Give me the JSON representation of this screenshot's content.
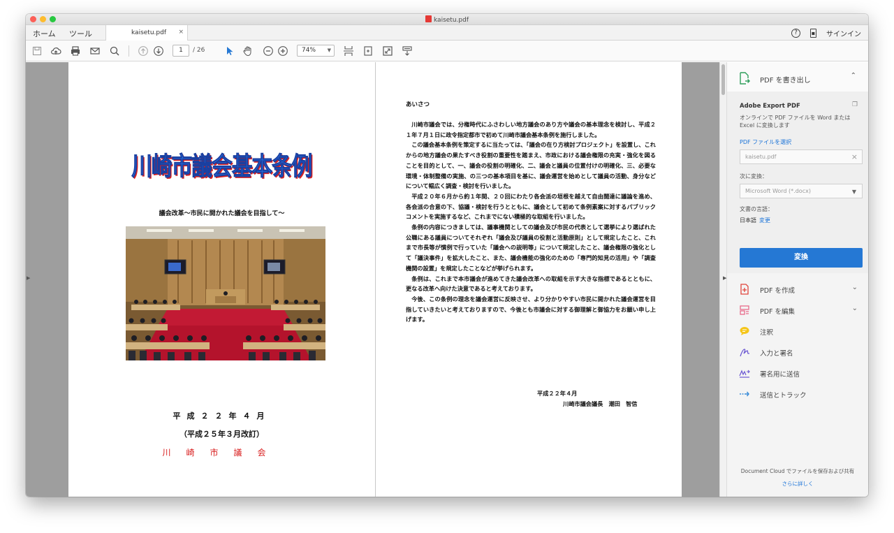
{
  "window": {
    "title": "kaisetu.pdf"
  },
  "tabbar": {
    "home": "ホーム",
    "tools": "ツール",
    "doc_tab": "kaisetu.pdf",
    "help_icon": "?",
    "sign_in": "サインイン"
  },
  "toolbar": {
    "page_current": "1",
    "page_total": "/ 26",
    "zoom": "74%"
  },
  "page_left": {
    "title": "川崎市議会基本条例",
    "subtitle": "議会改革～市民に開かれた議会を目指して～",
    "date": "平成２２年４月",
    "revision": "（平成２５年３月改訂）",
    "organization": "川崎市議会"
  },
  "page_right": {
    "heading": "あいさつ",
    "paragraphs": [
      "川崎市議会では、分権時代にふさわしい地方議会のあり方や議会の基本理念を検討し、平成２１年７月１日に政令指定都市で初めて川崎市議会基本条例を施行しました。",
      "この議会基本条例を策定するに当たっては、「議会の在り方検討プロジェクト」を設置し、これからの地方議会の果たすべき役割の重要性を踏まえ、市政における議会権限の充実・強化を図ることを目的として、一、議会の役割の明確化、二、議会と議員の位置付けの明確化、三、必要な環境・体制整備の実施、の三つの基本項目を基に、議会運営を始めとして議員の活動、身分などについて幅広く調査・検討を行いました。",
      "平成２０年６月から約１年間、２０回にわたり各会派の垣根を越えて自由闊達に議論を進め、各会派の合意の下、協議・検討を行うとともに、議会として初めて条例素案に対するパブリックコメントを実施するなど、これまでにない積極的な取組を行いました。",
      "条例の内容につきましては、議事機関としての議会及び市民の代表として選挙により選ばれた公職にある議員についてそれぞれ「議会及び議員の役割と活動原則」として規定したこと、これまで市長等が慣例で行っていた「議会への説明等」について規定したこと、議会権限の強化として「議決事件」を拡大したこと、また、議会機能の強化のための「専門的知見の活用」や「調査機関の設置」を規定したことなどが挙げられます。",
      "条例は、これまで本市議会が進めてきた議会改革への取組を示す大きな指標であるとともに、更なる改革へ向けた決意であると考えております。",
      "今後、この条例の理念を議会運営に反映させ、より分かりやすい市民に開かれた議会運営を目指していきたいと考えておりますので、今後とも市議会に対する御理解と御協力をお願い申し上げます。"
    ],
    "sign_date": "平成２２年４月",
    "sign_name": "川崎市議会議長　潮田　智信"
  },
  "side_panel": {
    "export_header": "PDF を書き出し",
    "export_title": "Adobe Export PDF",
    "export_desc": "オンラインで PDF ファイルを Word または Excel に変換します",
    "select_file_link": "PDF ファイルを選択",
    "file_input_value": "kaisetu.pdf",
    "convert_to_label": "次に変換：",
    "convert_to_value": "Microsoft Word (*.docx)",
    "language_label": "文書の言語：",
    "language_value": "日本語",
    "language_change": "変更",
    "convert_button": "変換",
    "tools": [
      {
        "label": "PDF を作成",
        "icon": "create-pdf-icon",
        "chevron": "⌄"
      },
      {
        "label": "PDF を編集",
        "icon": "edit-pdf-icon",
        "chevron": "⌄"
      },
      {
        "label": "注釈",
        "icon": "comment-icon",
        "chevron": ""
      },
      {
        "label": "入力と署名",
        "icon": "fill-sign-icon",
        "chevron": ""
      },
      {
        "label": "署名用に送信",
        "icon": "send-for-signature-icon",
        "chevron": ""
      },
      {
        "label": "送信とトラック",
        "icon": "send-track-icon",
        "chevron": ""
      }
    ],
    "doc_cloud_text": "Document Cloud でファイルを保存および共有",
    "learn_more": "さらに詳しく"
  },
  "colors": {
    "accent_blue": "#2578d4",
    "link_blue": "#1a73d8",
    "title_blue": "#2d7df0",
    "org_red": "#d81b1b"
  }
}
